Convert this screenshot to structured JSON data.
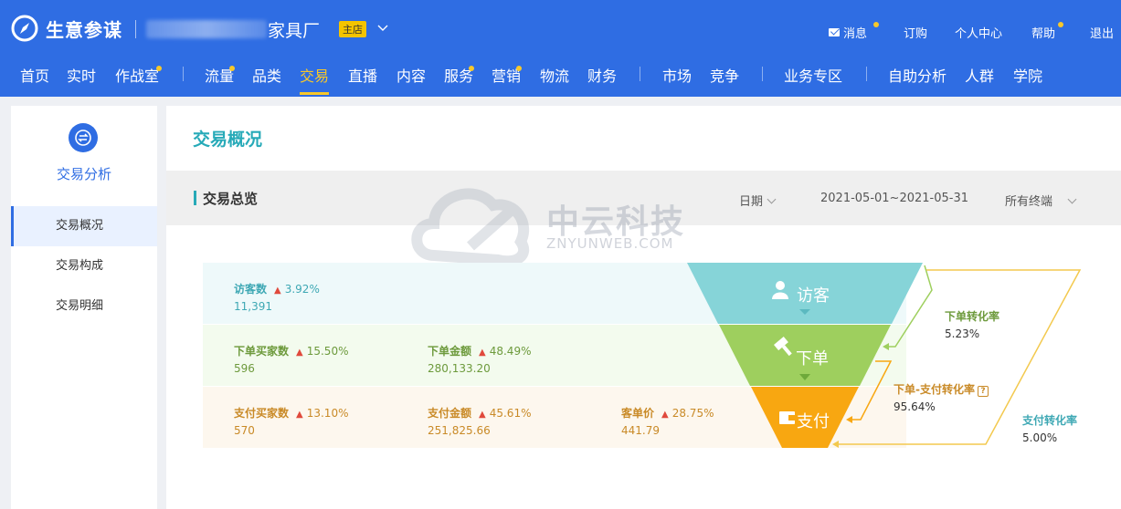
{
  "header": {
    "brand": "生意参谋",
    "shop_name": "家具厂",
    "shop_badge": "主店",
    "top_links": [
      {
        "label": "消息",
        "dot": true
      },
      {
        "label": "订购",
        "dot": false
      },
      {
        "label": "个人中心",
        "dot": false
      },
      {
        "label": "帮助",
        "dot": true
      },
      {
        "label": "退出",
        "dot": false
      }
    ]
  },
  "nav": {
    "items": [
      {
        "label": "首页"
      },
      {
        "label": "实时"
      },
      {
        "label": "作战室",
        "dot": true
      },
      {
        "label": "流量",
        "dot": true
      },
      {
        "label": "品类"
      },
      {
        "label": "交易",
        "active": true
      },
      {
        "label": "直播"
      },
      {
        "label": "内容"
      },
      {
        "label": "服务",
        "dot": true
      },
      {
        "label": "营销",
        "dot": true
      },
      {
        "label": "物流"
      },
      {
        "label": "财务"
      },
      {
        "label": "市场"
      },
      {
        "label": "竞争"
      },
      {
        "label": "业务专区"
      },
      {
        "label": "自助分析"
      },
      {
        "label": "人群"
      },
      {
        "label": "学院"
      }
    ]
  },
  "sidebar": {
    "title": "交易分析",
    "items": [
      {
        "label": "交易概况",
        "active": true
      },
      {
        "label": "交易构成"
      },
      {
        "label": "交易明细"
      }
    ]
  },
  "main": {
    "page_title": "交易概况",
    "section_title": "交易总览",
    "filter": {
      "date_label": "日期",
      "date_range": "2021-05-01~2021-05-31",
      "device": "所有终端"
    }
  },
  "watermark": {
    "name": "中云科技",
    "site": "ZNYUNWEB.COM"
  },
  "funnel": {
    "visitors": {
      "label": "访客数",
      "change": "3.92%",
      "value": "11,391"
    },
    "order_buyers": {
      "label": "下单买家数",
      "change": "15.50%",
      "value": "596"
    },
    "order_amount": {
      "label": "下单金额",
      "change": "48.49%",
      "value": "280,133.20"
    },
    "pay_buyers": {
      "label": "支付买家数",
      "change": "13.10%",
      "value": "570"
    },
    "pay_amount": {
      "label": "支付金额",
      "change": "45.61%",
      "value": "251,825.66"
    },
    "unit_price": {
      "label": "客单价",
      "change": "28.75%",
      "value": "441.79"
    },
    "stages": {
      "visit": "访客",
      "order": "下单",
      "pay": "支付"
    },
    "rates": {
      "order_rate": {
        "name": "下单转化率",
        "value": "5.23%"
      },
      "order_pay_rate": {
        "name": "下单-支付转化率",
        "value": "95.64%"
      },
      "pay_rate": {
        "name": "支付转化率",
        "value": "5.00%"
      }
    },
    "colors": {
      "visit": "#86d4d8",
      "order": "#9ecf5e",
      "pay": "#f8a711"
    }
  }
}
